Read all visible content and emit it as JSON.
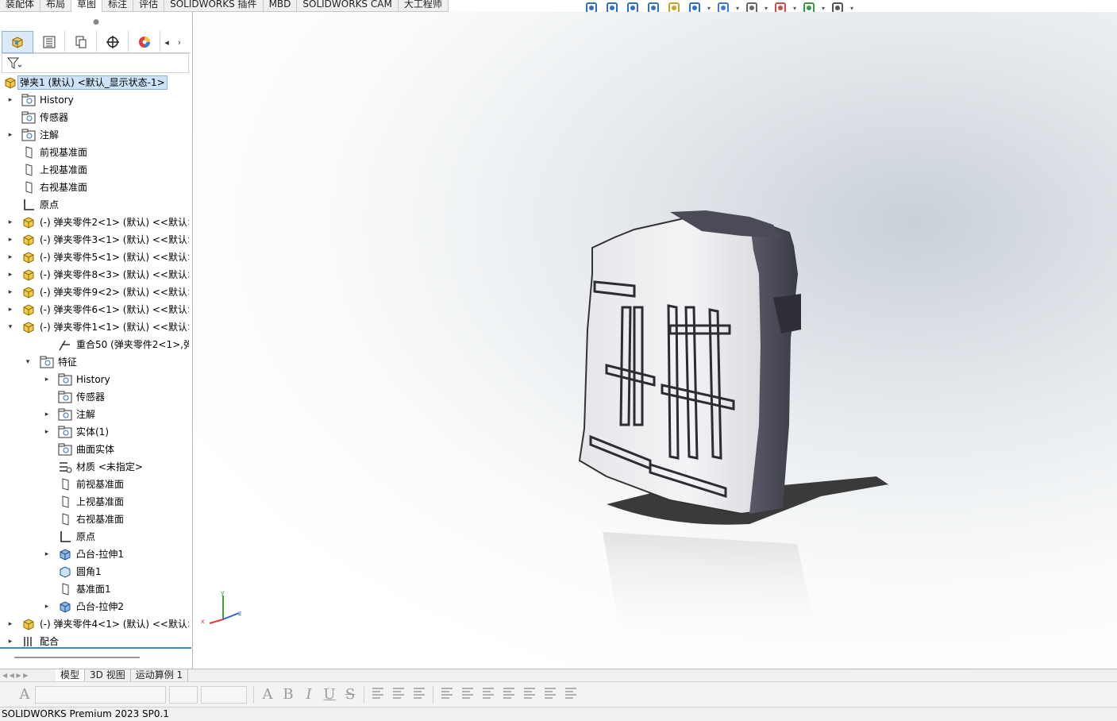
{
  "command_tabs": [
    {
      "label": "装配体",
      "active": false
    },
    {
      "label": "布局",
      "active": false
    },
    {
      "label": "草图",
      "active": true
    },
    {
      "label": "标注",
      "active": false
    },
    {
      "label": "评估",
      "active": false
    },
    {
      "label": "SOLIDWORKS 插件",
      "active": false
    },
    {
      "label": "MBD",
      "active": false
    },
    {
      "label": "SOLIDWORKS CAM",
      "active": false
    },
    {
      "label": "大工程师",
      "active": false
    }
  ],
  "heads_up_toolbar": [
    {
      "icon": "zoom-to-fit-icon"
    },
    {
      "icon": "zoom-to-area-icon"
    },
    {
      "icon": "previous-view-icon"
    },
    {
      "icon": "section-view-icon"
    },
    {
      "icon": "dynamic-annotation-icon"
    },
    {
      "icon": "view-orientation-icon"
    },
    {
      "icon": "display-style-icon"
    },
    {
      "icon": "hide-show-items-icon"
    },
    {
      "icon": "edit-appearance-icon"
    },
    {
      "icon": "apply-scene-icon"
    },
    {
      "icon": "view-settings-icon"
    }
  ],
  "panel": {
    "tabs": [
      "featuremanager-tab",
      "propertymanager-tab",
      "configurationmanager-tab",
      "dimxpert-tab",
      "displaymanager-tab"
    ],
    "root": {
      "label": "弹夹1 (默认) <默认_显示状态-1>"
    },
    "tree": [
      {
        "label": "History",
        "icon": "history-folder-icon",
        "exp": "▸"
      },
      {
        "label": "传感器",
        "icon": "sensor-folder-icon",
        "exp": ""
      },
      {
        "label": "注解",
        "icon": "annotations-folder-icon",
        "exp": "▸"
      },
      {
        "label": "前视基准面",
        "icon": "plane-icon",
        "exp": ""
      },
      {
        "label": "上视基准面",
        "icon": "plane-icon",
        "exp": ""
      },
      {
        "label": "右视基准面",
        "icon": "plane-icon",
        "exp": ""
      },
      {
        "label": "原点",
        "icon": "origin-icon",
        "exp": ""
      },
      {
        "label": "(-) 弹夹零件2<1> (默认) <<默认>_",
        "icon": "part-icon",
        "exp": "▸"
      },
      {
        "label": "(-) 弹夹零件3<1> (默认) <<默认>_",
        "icon": "part-icon",
        "exp": "▸"
      },
      {
        "label": "(-) 弹夹零件5<1> (默认) <<默认>_",
        "icon": "part-icon",
        "exp": "▸"
      },
      {
        "label": "(-) 弹夹零件8<3> (默认) <<默认>_",
        "icon": "part-icon",
        "exp": "▸"
      },
      {
        "label": "(-) 弹夹零件9<2> (默认) <<默认>_",
        "icon": "part-icon",
        "exp": "▸"
      },
      {
        "label": "(-) 弹夹零件6<1> (默认) <<默认>_",
        "icon": "part-icon",
        "exp": "▸"
      },
      {
        "label": "(-) 弹夹零件1<1> (默认) <<默认>_",
        "icon": "part-icon",
        "exp": "▾"
      },
      {
        "label": "重合50 (弹夹零件2<1>,弹:",
        "icon": "mate-coincident-icon",
        "exp": ""
      },
      {
        "label": "特征",
        "icon": "features-folder-icon",
        "exp": "▾"
      },
      {
        "label": "History",
        "icon": "history-folder-icon",
        "exp": "▸"
      },
      {
        "label": "传感器",
        "icon": "sensor-folder-icon",
        "exp": ""
      },
      {
        "label": "注解",
        "icon": "annotations-folder-icon",
        "exp": "▸"
      },
      {
        "label": "实体(1)",
        "icon": "solid-bodies-icon",
        "exp": "▸"
      },
      {
        "label": "曲面实体",
        "icon": "surface-bodies-icon",
        "exp": ""
      },
      {
        "label": "材质 <未指定>",
        "icon": "material-icon",
        "exp": ""
      },
      {
        "label": "前视基准面",
        "icon": "plane-icon",
        "exp": ""
      },
      {
        "label": "上视基准面",
        "icon": "plane-icon",
        "exp": ""
      },
      {
        "label": "右视基准面",
        "icon": "plane-icon",
        "exp": ""
      },
      {
        "label": "原点",
        "icon": "origin-icon",
        "exp": ""
      },
      {
        "label": "凸台-拉伸1",
        "icon": "boss-extrude-icon",
        "exp": "▸"
      },
      {
        "label": "圆角1",
        "icon": "fillet-icon",
        "exp": ""
      },
      {
        "label": "基准面1",
        "icon": "plane-icon",
        "exp": ""
      },
      {
        "label": "凸台-拉伸2",
        "icon": "boss-extrude-icon",
        "exp": "▸"
      },
      {
        "label": "(-) 弹夹零件4<1> (默认) <<默认>_",
        "icon": "part-icon",
        "exp": "▸"
      },
      {
        "label": "配合",
        "icon": "mates-folder-icon",
        "exp": "▸"
      }
    ]
  },
  "triad": {
    "x": "x",
    "y": "y",
    "z": "z"
  },
  "bottom_tabs": [
    {
      "label": "模型",
      "active": true
    },
    {
      "label": "3D 视图",
      "active": false
    },
    {
      "label": "运动算例 1",
      "active": false
    }
  ],
  "format_toolbar": {
    "glyphs": [
      {
        "name": "font-color-icon",
        "ch": "A"
      },
      {
        "name": "bold-icon",
        "ch": "B"
      },
      {
        "name": "italic-icon",
        "ch": "I"
      },
      {
        "name": "underline-icon",
        "ch": "U"
      },
      {
        "name": "strikethrough-icon",
        "ch": "S"
      }
    ],
    "align": [
      "align-left-icon",
      "align-center-icon",
      "align-right-icon"
    ],
    "misc": [
      "fit-text-icon",
      "stack-icon",
      "bullets-icon",
      "numbering-icon",
      "decrease-indent-icon",
      "increase-indent-icon",
      "line-spacing-icon"
    ]
  },
  "status_bar": {
    "text": "SOLIDWORKS Premium 2023 SP0.1"
  }
}
